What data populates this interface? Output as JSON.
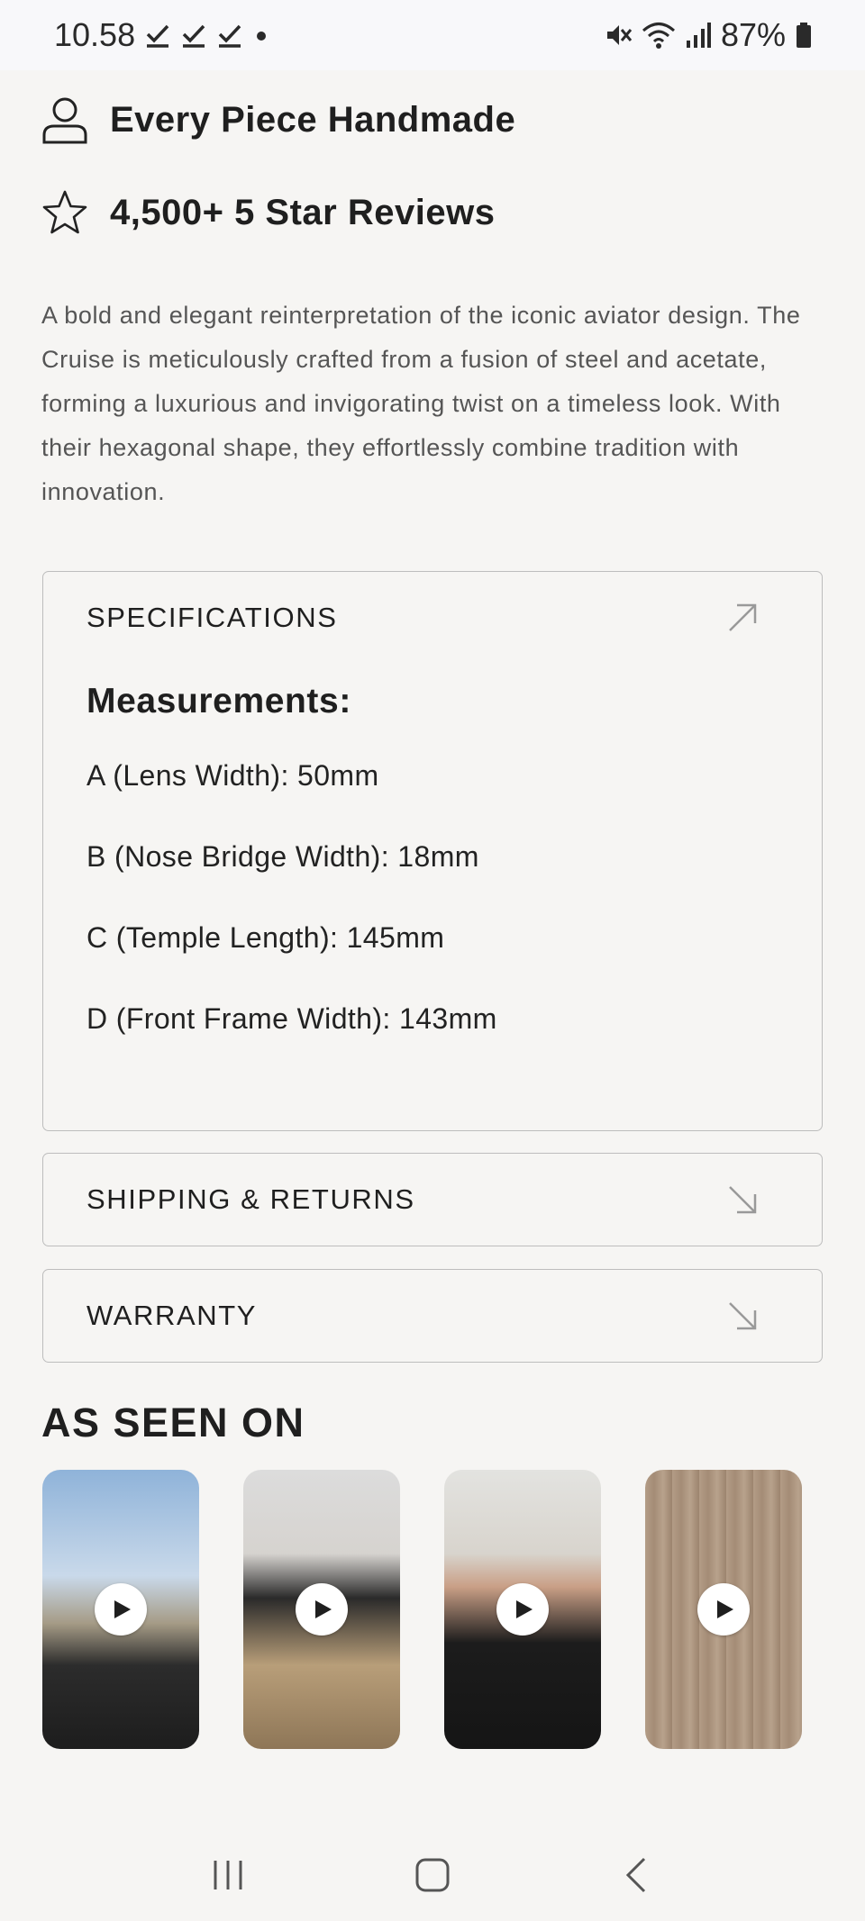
{
  "status_bar": {
    "time": "10.58",
    "battery": "87%"
  },
  "features": [
    {
      "icon": "user-icon",
      "label": "Every Piece Handmade"
    },
    {
      "icon": "star-icon",
      "label": "4,500+ 5 Star Reviews"
    }
  ],
  "description": "A bold and elegant reinterpretation of the iconic aviator design. The Cruise is meticulously crafted from a fusion of steel and acetate, forming a luxurious and invigorating twist on a timeless look. With their hexagonal shape, they effortlessly combine tradition with innovation.",
  "specifications": {
    "title": "SPECIFICATIONS",
    "subtitle": "Measurements:",
    "items": [
      "A (Lens Width): 50mm",
      "B (Nose Bridge Width): 18mm",
      "C (Temple Length): 145mm",
      "D (Front Frame Width): 143mm"
    ]
  },
  "shipping": {
    "title": "SHIPPING & RETURNS"
  },
  "warranty": {
    "title": "WARRANTY"
  },
  "as_seen_on": {
    "title": "AS SEEN ON",
    "videos": [
      {
        "icon": "play-icon"
      },
      {
        "icon": "play-icon"
      },
      {
        "icon": "play-icon"
      },
      {
        "icon": "play-icon"
      }
    ]
  },
  "nav": {
    "recents": "recents-icon",
    "home": "home-icon",
    "back": "back-icon"
  },
  "colors": {
    "background": "#f6f5f3",
    "text": "#1f1f1f",
    "muted": "#555555",
    "border": "#bdbdbd"
  }
}
